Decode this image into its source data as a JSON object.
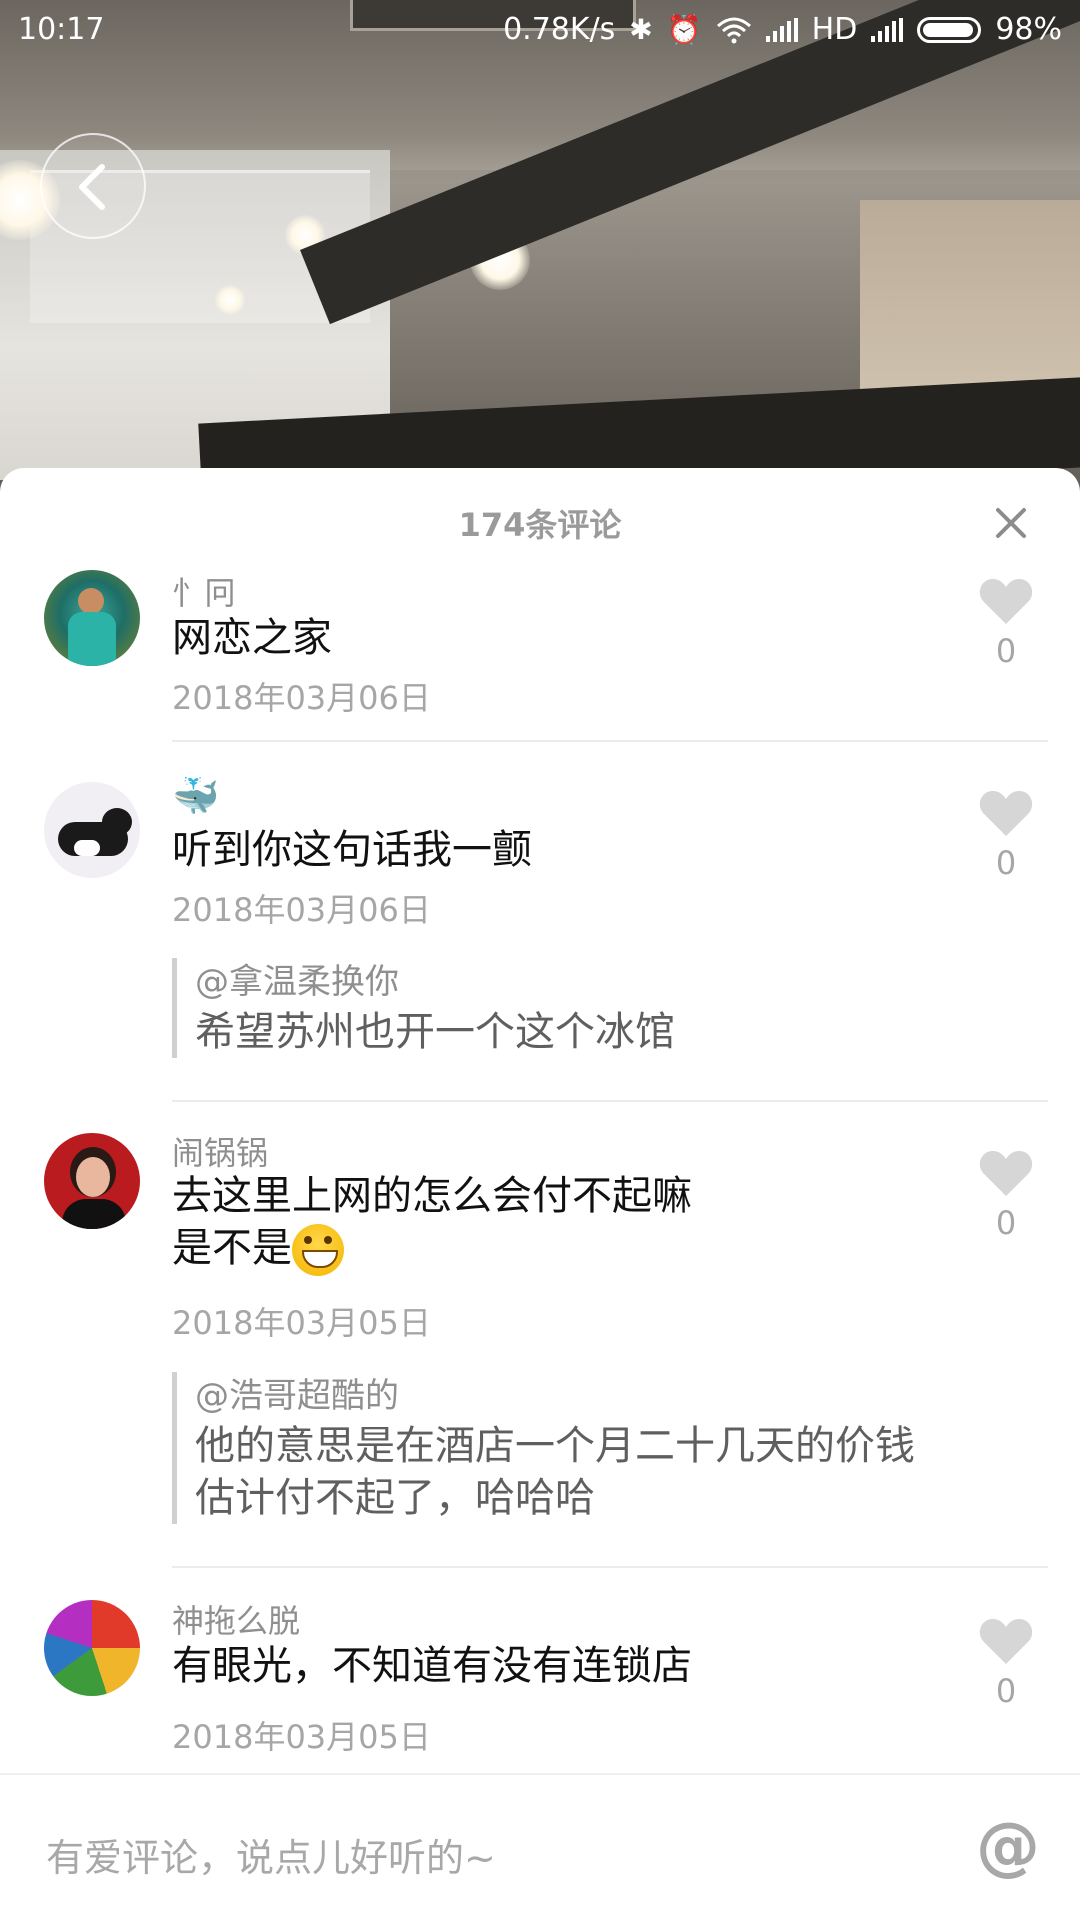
{
  "status_bar": {
    "time": "10:17",
    "net_speed": "0.78K/s",
    "network": "HD",
    "battery": "98%",
    "battery_level": 0.98
  },
  "sheet": {
    "title": "174条评论",
    "close_icon": "close-icon"
  },
  "comments": [
    {
      "user": "忄冋",
      "text": "网恋之家",
      "date": "2018年03月06日",
      "likes": "0"
    },
    {
      "user": "🐳",
      "text": "听到你这句话我一颤",
      "date": "2018年03月06日",
      "likes": "0",
      "reply": {
        "user": "@拿温柔换你",
        "text": "希望苏州也开一个这个冰馆"
      }
    },
    {
      "user": "闹锅锅",
      "text_line1": "去这里上网的怎么会付不起嘛",
      "text_line2": "是不是",
      "date": "2018年03月05日",
      "likes": "0",
      "reply": {
        "user": "@浩哥超酷的",
        "text_line1": "他的意思是在酒店一个月二十几天的价钱",
        "text_line2": "估计付不起了，哈哈哈"
      }
    },
    {
      "user": "神拖么脱",
      "text": "有眼光，不知道有没有连锁店",
      "date": "2018年03月05日",
      "likes": "0"
    }
  ],
  "input": {
    "placeholder": "有爱评论，说点儿好听的~",
    "at_label": "@"
  },
  "colors": {
    "sheet_bg": "#ffffff",
    "secondary_text": "#a6a6a6",
    "primary_text": "#111111"
  }
}
